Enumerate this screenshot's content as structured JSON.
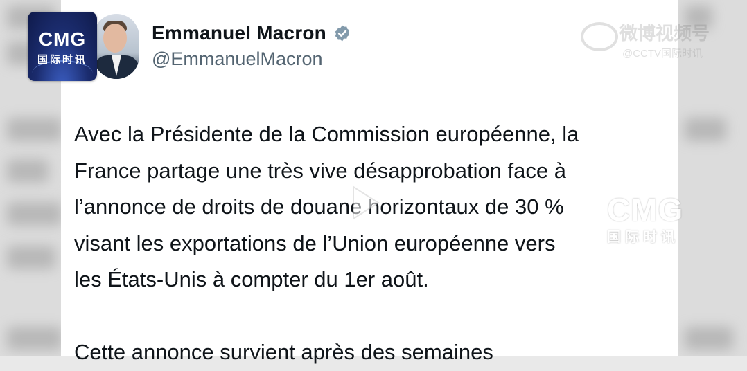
{
  "tweet": {
    "author_name": "Emmanuel Macron",
    "author_handle": "@EmmanuelMacron",
    "verified": true,
    "text_lines": [
      "Avec la Présidente de la Commission européenne, la",
      "France partage une très vive désapprobation face à",
      "l’annonce de droits de douane horizontaux de 30 %",
      "visant les exportations de l’Union européenne vers",
      "les États-Unis à compter du 1er août.",
      "Cette annonce survient après des semaines"
    ]
  },
  "channel_logo": {
    "text": "CMG",
    "subtext": "国际时讯",
    "color": "#1b2c6e"
  },
  "watermarks": {
    "weibo_line1": "微博视频号",
    "weibo_line2": "@CCTV国际时讯",
    "cmg_text": "CMG",
    "cmg_subtext": "国际时讯"
  },
  "colors": {
    "text": "#0f1419",
    "handle": "#536471",
    "verified": "#829aab"
  }
}
